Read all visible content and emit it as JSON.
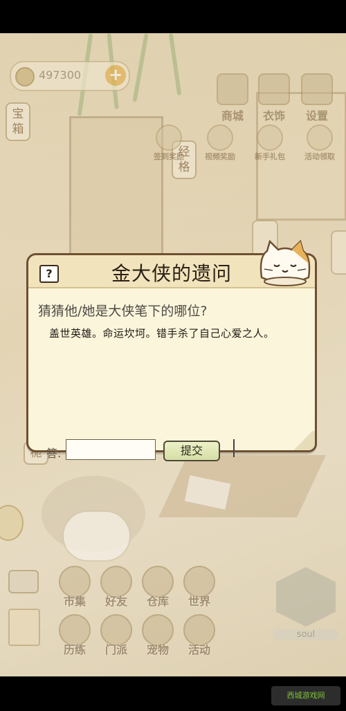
{
  "hud": {
    "coins": "497300",
    "plus_label": "+"
  },
  "side_tags": {
    "treasure": "宝箱",
    "grid": "经格",
    "left_tag": "桅"
  },
  "top_menu": [
    {
      "label": "商城"
    },
    {
      "label": "衣饰"
    },
    {
      "label": "设置"
    }
  ],
  "mini_menu": [
    {
      "label": "签到奖励"
    },
    {
      "label": "视频奖励"
    },
    {
      "label": "新手礼包"
    },
    {
      "label": "活动领取"
    }
  ],
  "bottom_menu": [
    {
      "label": "市集"
    },
    {
      "label": "好友"
    },
    {
      "label": "仓库"
    },
    {
      "label": "世界"
    },
    {
      "label": "历练"
    },
    {
      "label": "门派"
    },
    {
      "label": "宠物"
    },
    {
      "label": "活动"
    }
  ],
  "soul_label": "soul",
  "dialog": {
    "icon": "?",
    "title": "金大侠的遗问",
    "question": "猜猜他/她是大侠笔下的哪位?",
    "hint": "盖世英雄。命运坎坷。错手杀了自己心爱之人。",
    "answer_label": "答:",
    "answer_value": "",
    "submit_label": "提交"
  },
  "watermark": "西城游戏网",
  "colors": {
    "dialog_border": "#6e4f2f",
    "dialog_bg": "#fbf5dc",
    "coin_plus": "#e0a93f"
  }
}
